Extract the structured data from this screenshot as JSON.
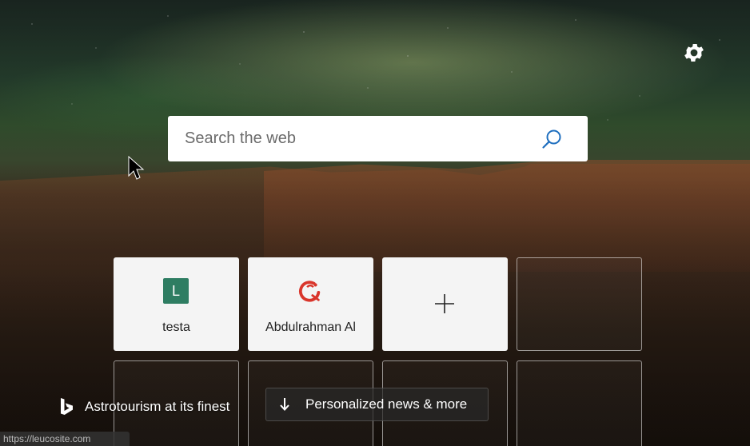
{
  "search": {
    "placeholder": "Search the web"
  },
  "tiles": [
    {
      "label": "testa",
      "icon": "letter-l-badge",
      "icon_letter": "L",
      "icon_color": "#2e7d62"
    },
    {
      "label": "Abdulrahman Al",
      "icon": "abdulrahman-logo-icon",
      "icon_color": "#d9352b"
    },
    {
      "label": "",
      "icon": "plus-icon"
    },
    {
      "label": "",
      "icon": ""
    },
    {
      "label": "",
      "icon": ""
    },
    {
      "label": "",
      "icon": ""
    },
    {
      "label": "",
      "icon": ""
    },
    {
      "label": "",
      "icon": ""
    }
  ],
  "footer": {
    "image_caption": "Astrotourism at its finest",
    "news_button_label": "Personalized news & more",
    "status_url": "https://leucosite.com"
  },
  "icons": {
    "settings": "gear-icon",
    "search": "search-icon",
    "bing": "bing-logo-icon",
    "news_arrow": "arrow-down-icon"
  },
  "colors": {
    "search_icon": "#1f6fbf",
    "tile_bg": "#f4f4f4"
  }
}
